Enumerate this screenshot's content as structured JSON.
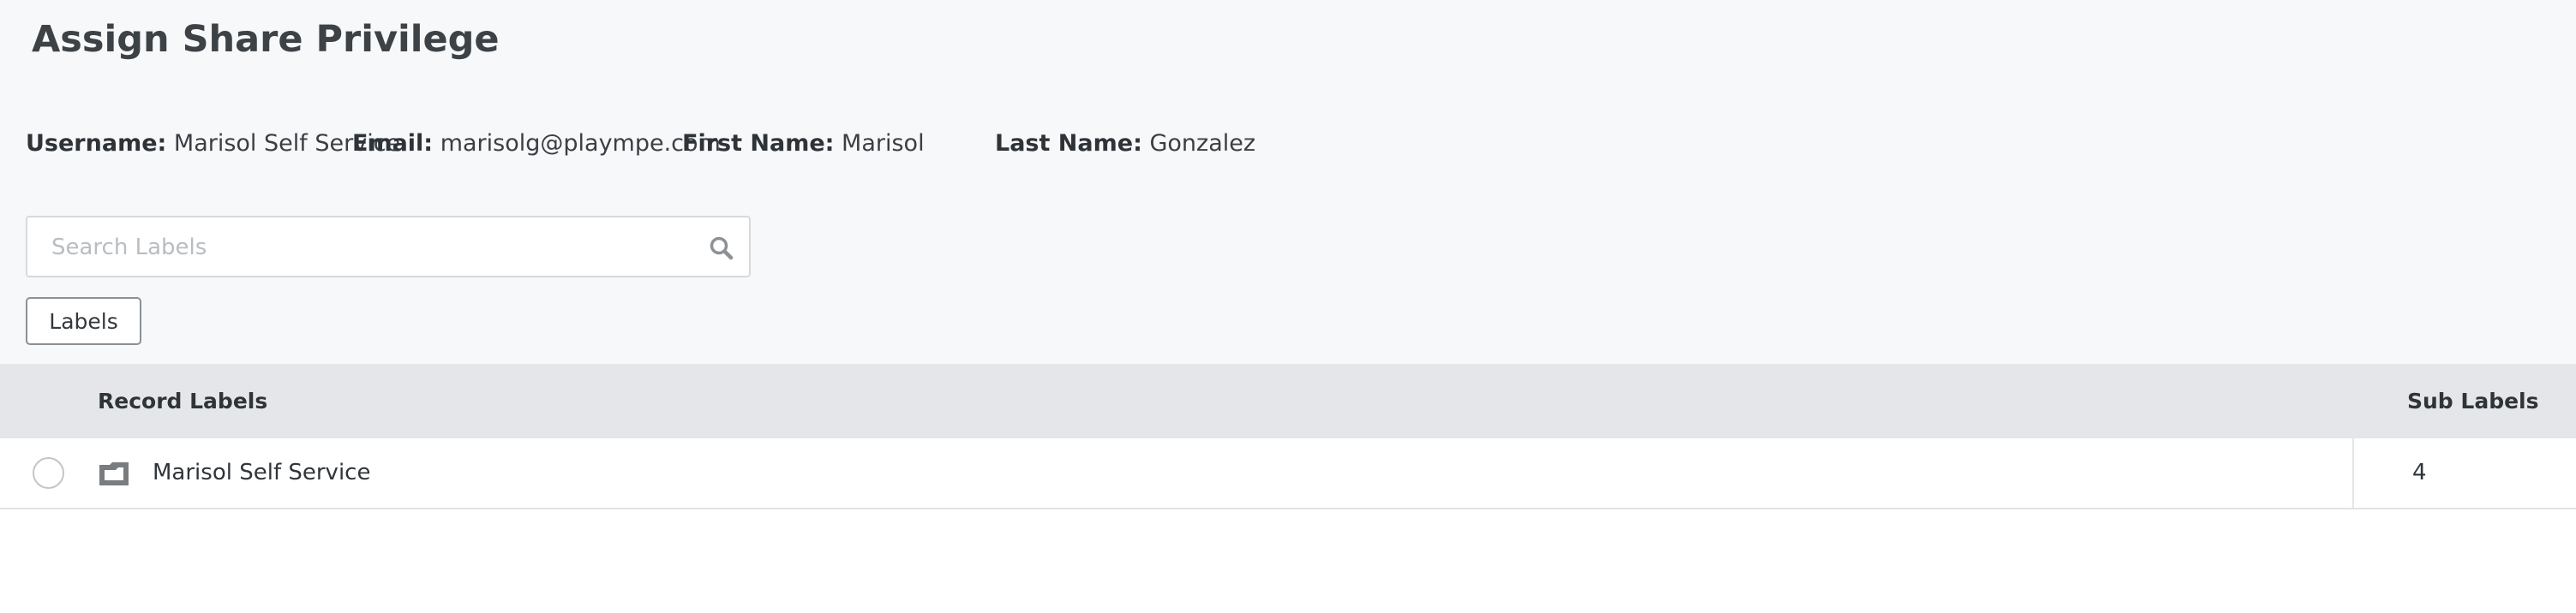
{
  "page": {
    "title": "Assign Share Privilege"
  },
  "user": {
    "username_label": "Username:",
    "username_value": "Marisol Self Service",
    "email_label": "Email:",
    "email_value": "marisolg@plaympe.com",
    "first_name_label": "First Name:",
    "first_name_value": "Marisol",
    "last_name_label": "Last Name:",
    "last_name_value": "Gonzalez"
  },
  "search": {
    "placeholder": "Search Labels",
    "value": "",
    "icon": "search-icon"
  },
  "filter": {
    "labels_button": "Labels"
  },
  "table": {
    "columns": {
      "record_labels": "Record Labels",
      "sub_labels": "Sub Labels"
    },
    "rows": [
      {
        "name": "Marisol Self Service",
        "sub_labels": "4",
        "selected": false,
        "icon": "folder-icon"
      }
    ]
  },
  "colors": {
    "page_background": "#f7f8fa",
    "header_background": "#e4e6ea",
    "text": "#333a40"
  }
}
